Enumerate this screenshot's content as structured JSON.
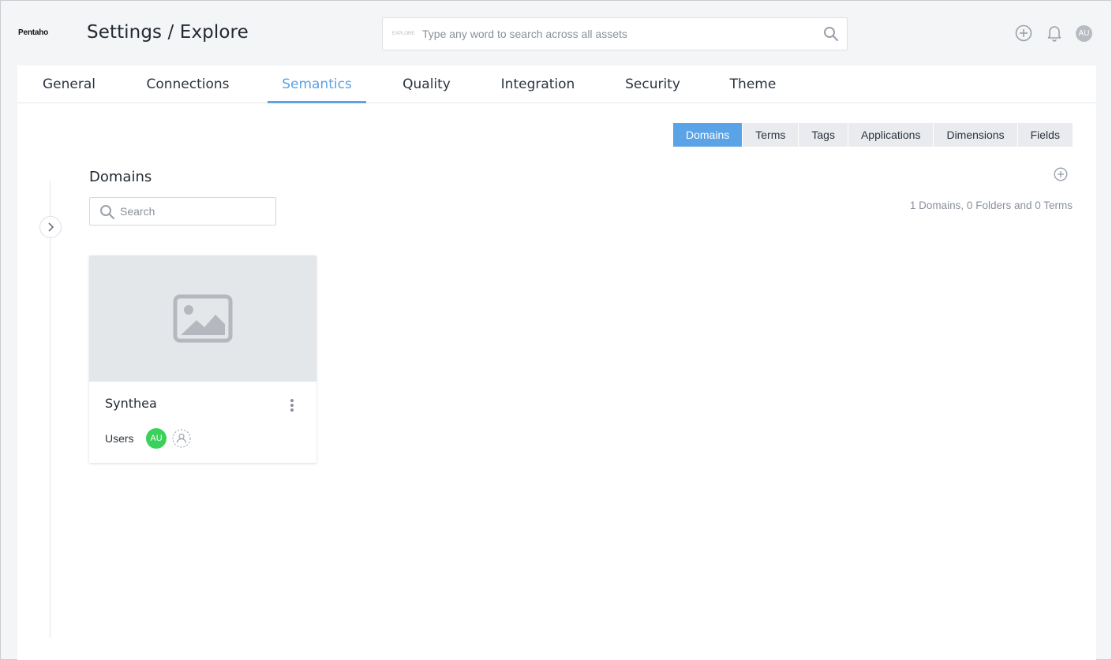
{
  "header": {
    "brand": "Pentaho",
    "title": "Settings / Explore",
    "search": {
      "scope_label": "EXPLORE",
      "placeholder": "Type any word to search across all assets",
      "value": ""
    },
    "avatar_initials": "AU"
  },
  "tabs": [
    {
      "label": "General"
    },
    {
      "label": "Connections"
    },
    {
      "label": "Semantics",
      "active": true
    },
    {
      "label": "Quality"
    },
    {
      "label": "Integration"
    },
    {
      "label": "Security"
    },
    {
      "label": "Theme"
    }
  ],
  "subtabs": [
    {
      "label": "Domains",
      "active": true
    },
    {
      "label": "Terms"
    },
    {
      "label": "Tags"
    },
    {
      "label": "Applications"
    },
    {
      "label": "Dimensions"
    },
    {
      "label": "Fields"
    }
  ],
  "domains": {
    "title": "Domains",
    "search_placeholder": "Search",
    "summary": "1 Domains, 0 Folders and 0 Terms",
    "cards": [
      {
        "name": "Synthea",
        "users_label": "Users",
        "user_initials": "AU"
      }
    ]
  },
  "colors": {
    "accent": "#5aa3e6",
    "user_avatar": "#3ad15a"
  }
}
